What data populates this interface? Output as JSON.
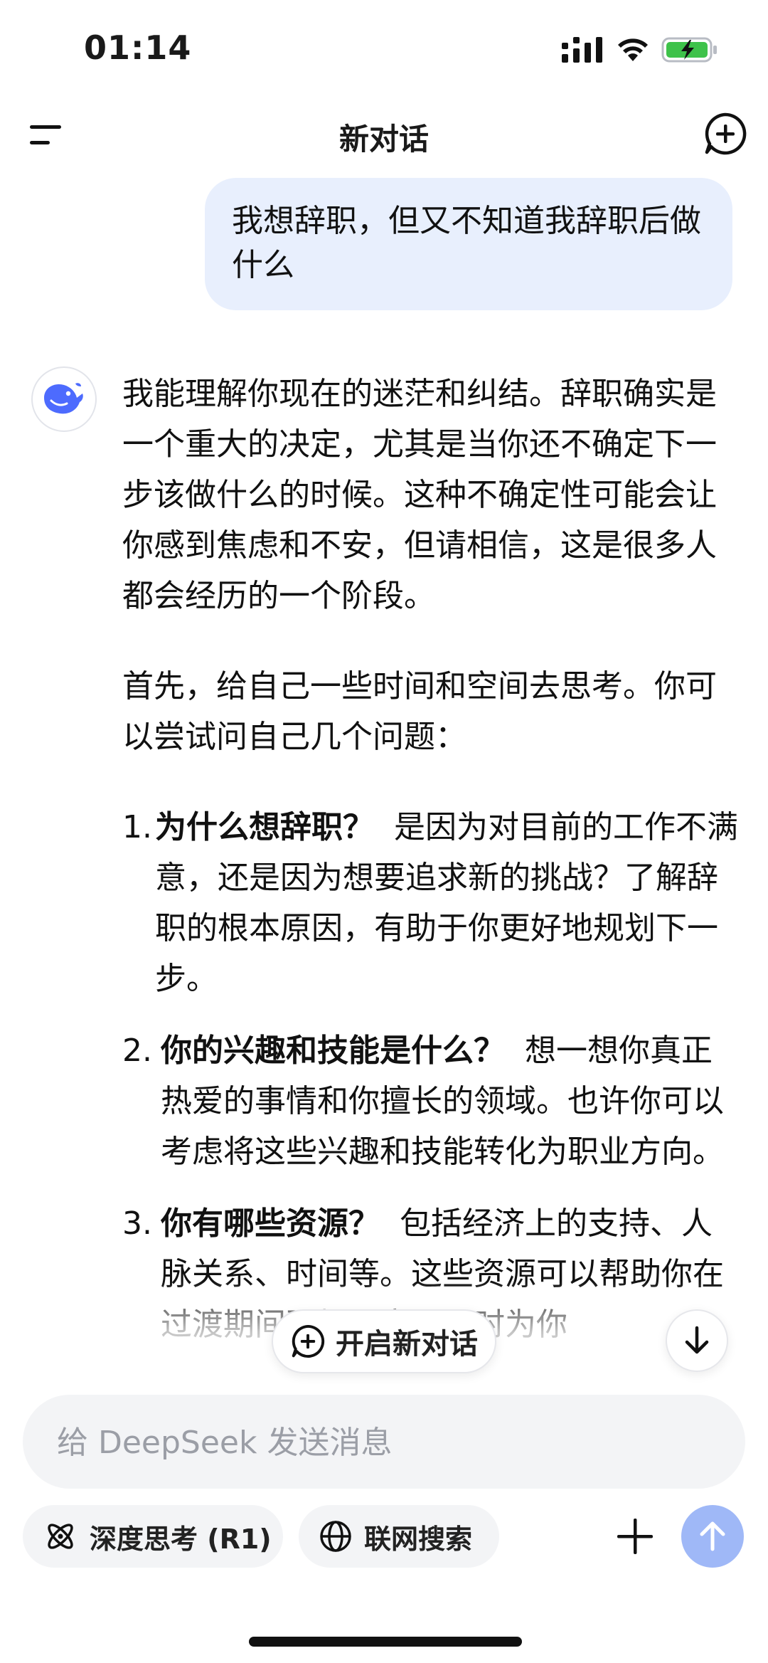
{
  "status_bar": {
    "time": "01:14"
  },
  "header": {
    "title": "新对话"
  },
  "user_message": "我想辞职，但又不知道我辞职后做什么",
  "assistant": {
    "intro": "我能理解你现在的迷茫和纠结。辞职确实是一个重大的决定，尤其是当你还不确定下一步该做什么的时候。这种不确定性可能会让你感到焦虑和不安，但请相信，这是很多人都会经历的一个阶段。",
    "lead": "首先，给自己一些时间和空间去思考。你可以尝试问自己几个问题：",
    "items": [
      {
        "num": "1.",
        "title": "为什么想辞职？",
        "text": "是因为对目前的工作不满意，还是因为想要追求新的挑战？了解辞职的根本原因，有助于你更好地规划下一步。"
      },
      {
        "num": "2.",
        "title": "你的兴趣和技能是什么？",
        "text": "想一想你真正热爱的事情和你擅长的领域。也许你可以考虑将这些兴趣和技能转化为职业方向。"
      },
      {
        "num": "3.",
        "title": "你有哪些资源？",
        "text": "包括经济上的支持、人脉关系、时间等。这些资源可以帮助你在过渡期间更加从容，同时为你"
      }
    ]
  },
  "floating": {
    "new_chat_label": "开启新对话"
  },
  "composer": {
    "placeholder": "给 DeepSeek 发送消息",
    "deep_think_label": "深度思考 (R1)",
    "web_search_label": "联网搜索"
  },
  "colors": {
    "accent": "#4d6bfe",
    "bubble": "#e8effd",
    "send_disabled": "#9fb8f7"
  }
}
